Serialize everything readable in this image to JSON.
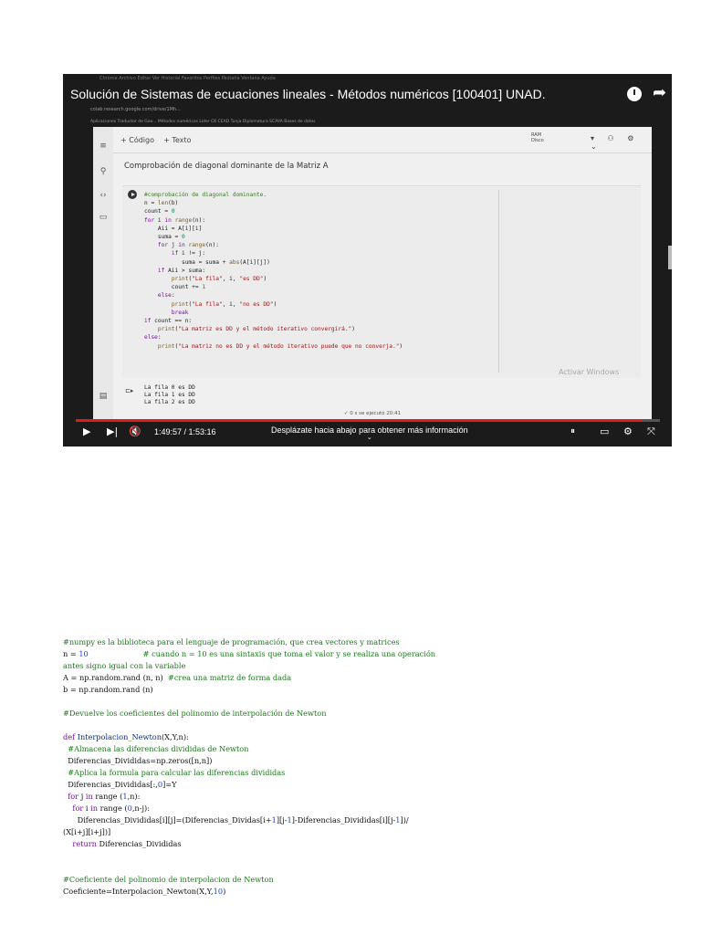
{
  "video": {
    "title": "Solución de Sistemas de ecuaciones lineales - Métodos numéricos [100401] UNAD.",
    "mac_menu": "Chrome  Archivo  Editar  Ver  Historial  Favoritos  Perfiles  Pestaña  Ventana  Ayuda",
    "url": "colab.research.google.com/drive/1Mh...",
    "bookmarks": "Aplicaciones   Traductor de Goo...   Métodos numéricos   Lider CK   CEAD Tunja   Diplomatura SCAVA   Bases de datos",
    "colab_toolbar_code": "+ Código",
    "colab_toolbar_text": "+ Texto",
    "ram_label": "RAM",
    "disk_label": "Disco",
    "section_title": "Comprobación de diagonal dominante de la Matriz A",
    "output_lines": [
      "La fila 0 es DD",
      "La fila 1 es DD",
      "La fila 2 es DD"
    ],
    "status_text": "✓ 0 s   se ejecutó 20:41",
    "watermark": "Activar Windows",
    "time": "1:49:57 / 1:53:16",
    "scroll_hint": "Desplázate hacia abajo para obtener más información",
    "progress": 0.97,
    "accent_color": "#e01b1b"
  }
}
